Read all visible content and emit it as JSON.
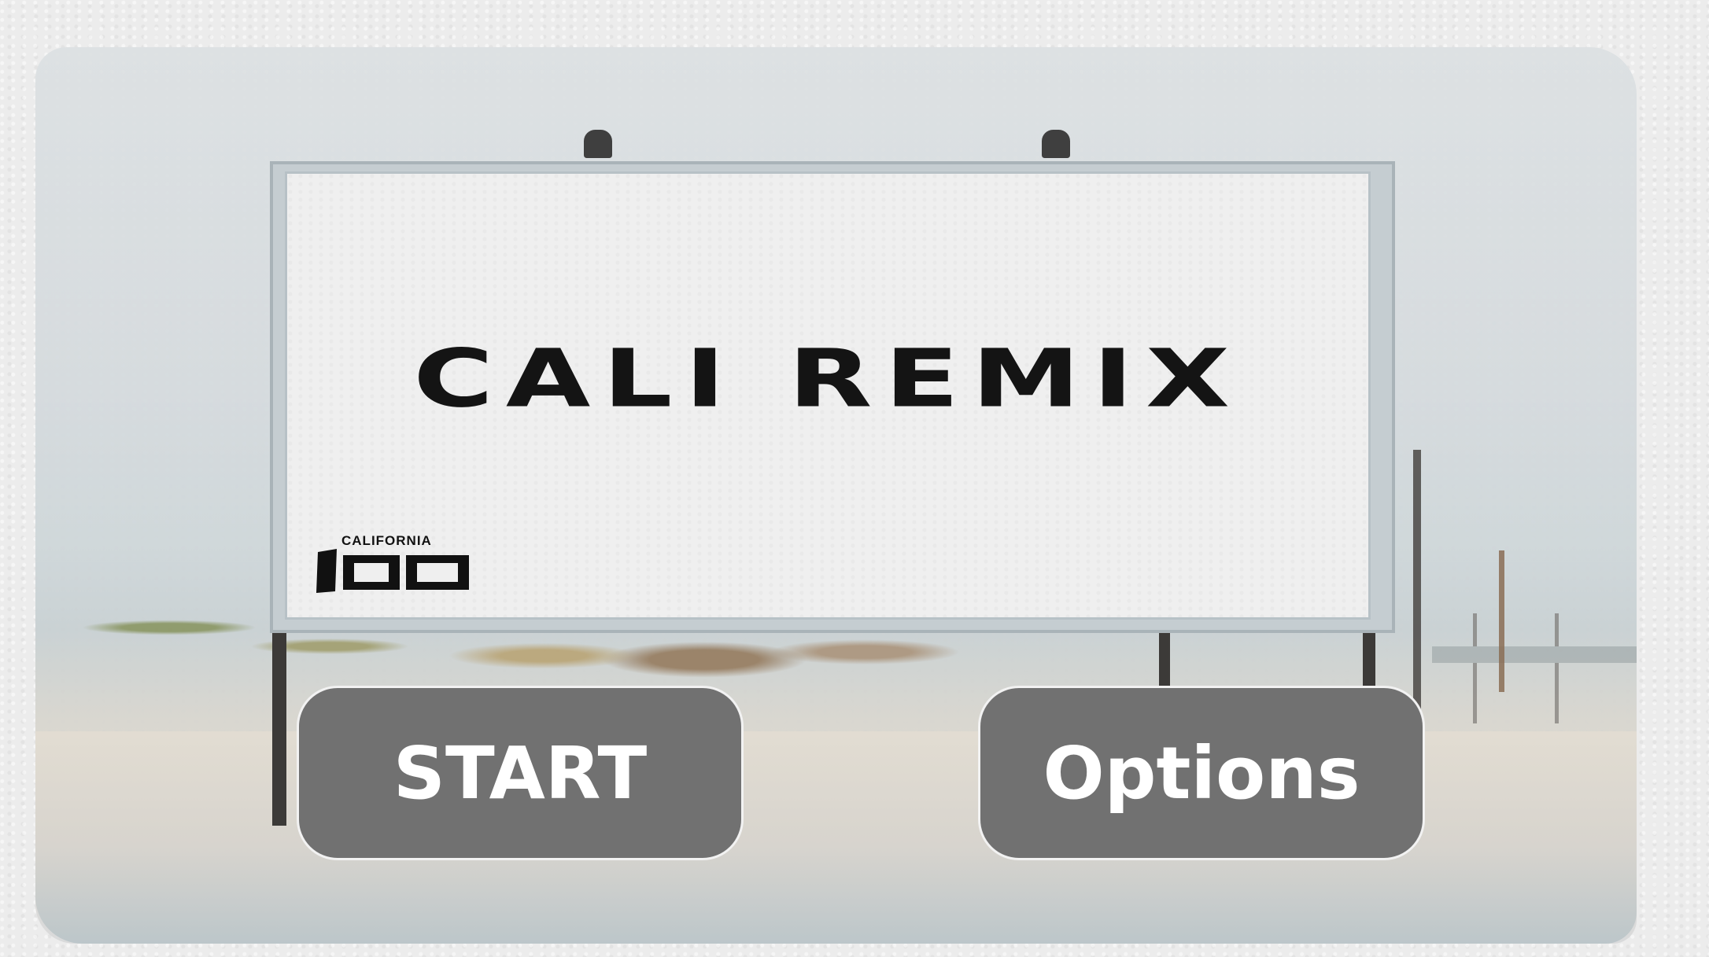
{
  "game": {
    "title": "CALI REMIX",
    "logo_text": "CALIFORNIA",
    "logo_number": "100"
  },
  "menu": {
    "start_label": "START",
    "options_label": "Options"
  },
  "colors": {
    "button_fill": "#717171",
    "button_text": "#ffffff",
    "title_text": "#141414",
    "billboard_face": "#efefef"
  }
}
